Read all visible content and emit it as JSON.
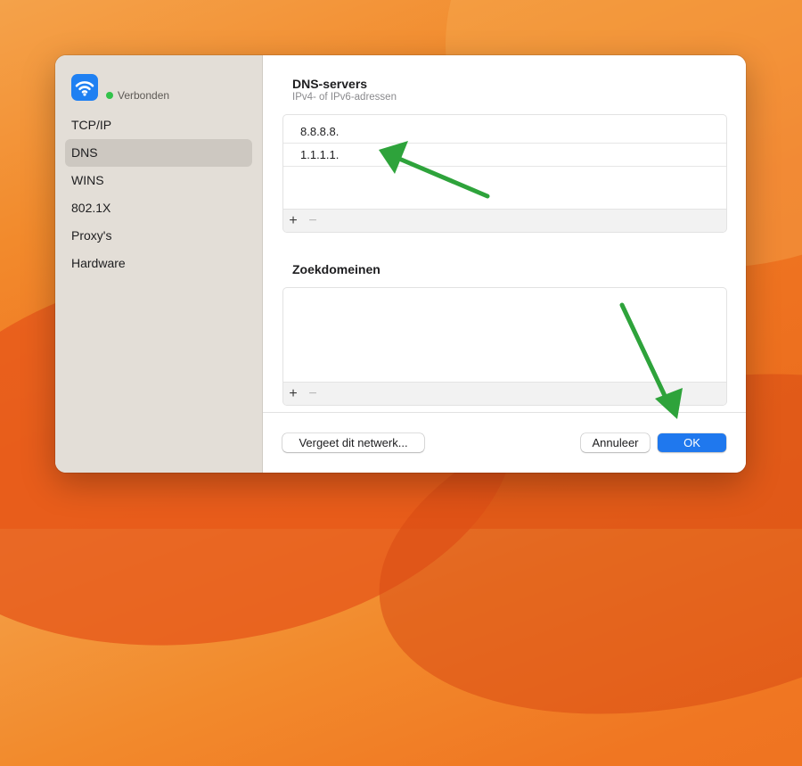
{
  "colors": {
    "accent": "#1f78ee",
    "status_connected": "#32c24a",
    "annotation_arrow": "#2ea33b",
    "sidebar_bg": "#e3ded7",
    "sidebar_selected": "#cdc8c1"
  },
  "sidebar": {
    "icon": "wifi-icon",
    "status": "Verbonden",
    "items": [
      {
        "label": "TCP/IP"
      },
      {
        "label": "DNS",
        "selected": true
      },
      {
        "label": "WINS"
      },
      {
        "label": "802.1X"
      },
      {
        "label": "Proxy's"
      },
      {
        "label": "Hardware"
      }
    ]
  },
  "dns": {
    "title": "DNS-servers",
    "subtitle": "IPv4- of IPv6-adressen",
    "servers": [
      "8.8.8.8.",
      "1.1.1.1."
    ],
    "add_symbol": "+",
    "remove_symbol": "−"
  },
  "search_domains": {
    "title": "Zoekdomeinen",
    "add_symbol": "+",
    "remove_symbol": "−"
  },
  "buttons": {
    "forget": "Vergeet dit netwerk...",
    "cancel": "Annuleer",
    "ok": "OK"
  }
}
